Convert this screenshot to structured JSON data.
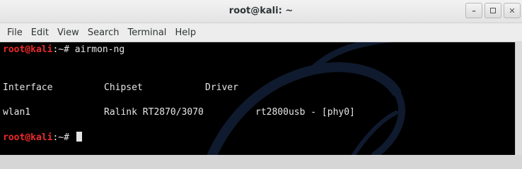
{
  "window": {
    "title": "root@kali: ~"
  },
  "menu": [
    "File",
    "Edit",
    "View",
    "Search",
    "Terminal",
    "Help"
  ],
  "terminal": {
    "prompt_user": "root@kali",
    "prompt_path": ":~# ",
    "command": "airmon-ng",
    "headers": [
      "Interface",
      "Chipset",
      "Driver"
    ],
    "row": {
      "interface": "wlan1",
      "chipset": "Ralink RT2870/3070",
      "driver": "rt2800usb - [phy0]"
    }
  },
  "colors": {
    "prompt_user": "#ef2929",
    "terminal_bg": "#000000",
    "terminal_fg": "#e5e5e5"
  }
}
